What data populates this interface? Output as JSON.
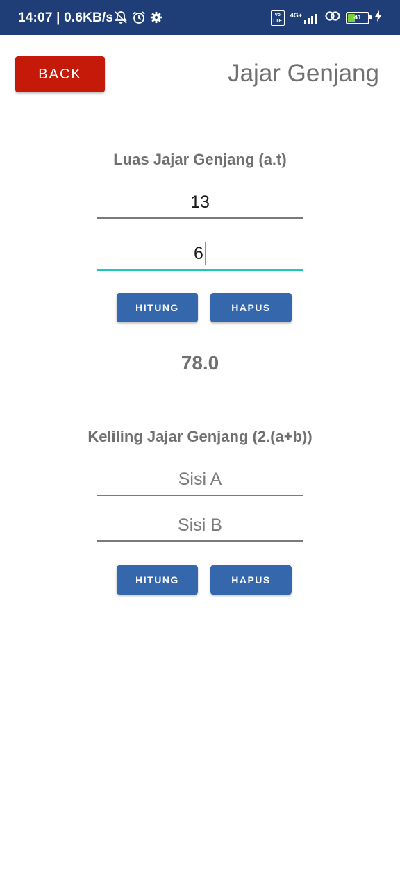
{
  "status_bar": {
    "time": "14:07 | 0.6KB/s",
    "network_label": "4G+",
    "volte_label": "Vo LTE",
    "battery_level": "41"
  },
  "header": {
    "back_label": "BACK",
    "title": "Jajar Genjang"
  },
  "luas": {
    "title": "Luas Jajar Genjang (a.t)",
    "alas_value": "13",
    "tinggi_value": "6",
    "hitung_label": "HITUNG",
    "hapus_label": "HAPUS",
    "result": "78.0"
  },
  "keliling": {
    "title": "Keliling Jajar Genjang (2.(a+b))",
    "sisi_a_placeholder": "Sisi A",
    "sisi_b_placeholder": "Sisi B",
    "hitung_label": "HITUNG",
    "hapus_label": "HAPUS"
  }
}
